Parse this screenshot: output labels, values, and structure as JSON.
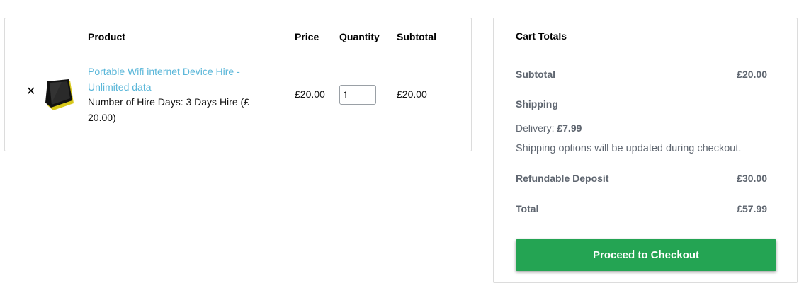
{
  "cart": {
    "headers": {
      "product": "Product",
      "price": "Price",
      "quantity": "Quantity",
      "subtotal": "Subtotal"
    },
    "items": [
      {
        "remove_symbol": "✕",
        "thumbnail_icon": "wifi-device-icon",
        "name": "Portable Wifi internet Device Hire - Unlimited data",
        "meta": "Number of Hire Days: 3 Days Hire (£ 20.00)",
        "price": "£20.00",
        "quantity": "1",
        "subtotal": "£20.00"
      }
    ]
  },
  "totals": {
    "title": "Cart Totals",
    "subtotal_label": "Subtotal",
    "subtotal_value": "£20.00",
    "shipping_label": "Shipping",
    "delivery_label": "Delivery: ",
    "delivery_value": "£7.99",
    "shipping_note": "Shipping options will be updated during checkout.",
    "deposit_label": "Refundable Deposit",
    "deposit_value": "£30.00",
    "total_label": "Total",
    "total_value": "£57.99",
    "checkout_label": "Proceed to Checkout"
  },
  "colors": {
    "link": "#5bb7d9",
    "checkout_button": "#24a453",
    "totals_text": "#5f6670"
  }
}
